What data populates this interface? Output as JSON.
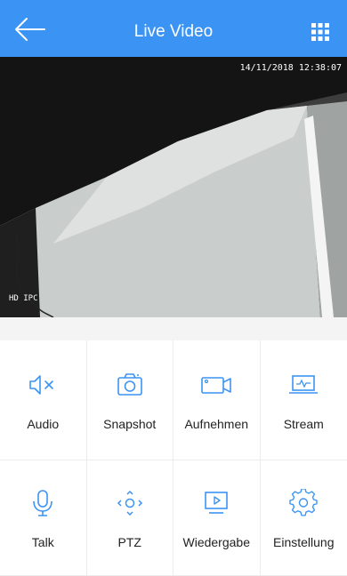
{
  "header": {
    "title": "Live Video",
    "back_icon": "back-arrow-icon",
    "menu_icon": "grid-menu-icon"
  },
  "video": {
    "timestamp": "14/11/2018 12:38:07",
    "overlay_label": "HD IPC"
  },
  "controls": [
    {
      "label": "Audio",
      "icon": "speaker-muted-icon"
    },
    {
      "label": "Snapshot",
      "icon": "camera-icon"
    },
    {
      "label": "Aufnehmen",
      "icon": "video-record-icon"
    },
    {
      "label": "Stream",
      "icon": "laptop-stream-icon"
    },
    {
      "label": "Talk",
      "icon": "microphone-icon"
    },
    {
      "label": "PTZ",
      "icon": "ptz-arrows-icon"
    },
    {
      "label": "Wiedergabe",
      "icon": "playback-icon"
    },
    {
      "label": "Einstellung",
      "icon": "gear-icon"
    }
  ],
  "colors": {
    "header": "#3b94f3",
    "accent": "#3b94f3",
    "text": "#222222"
  }
}
